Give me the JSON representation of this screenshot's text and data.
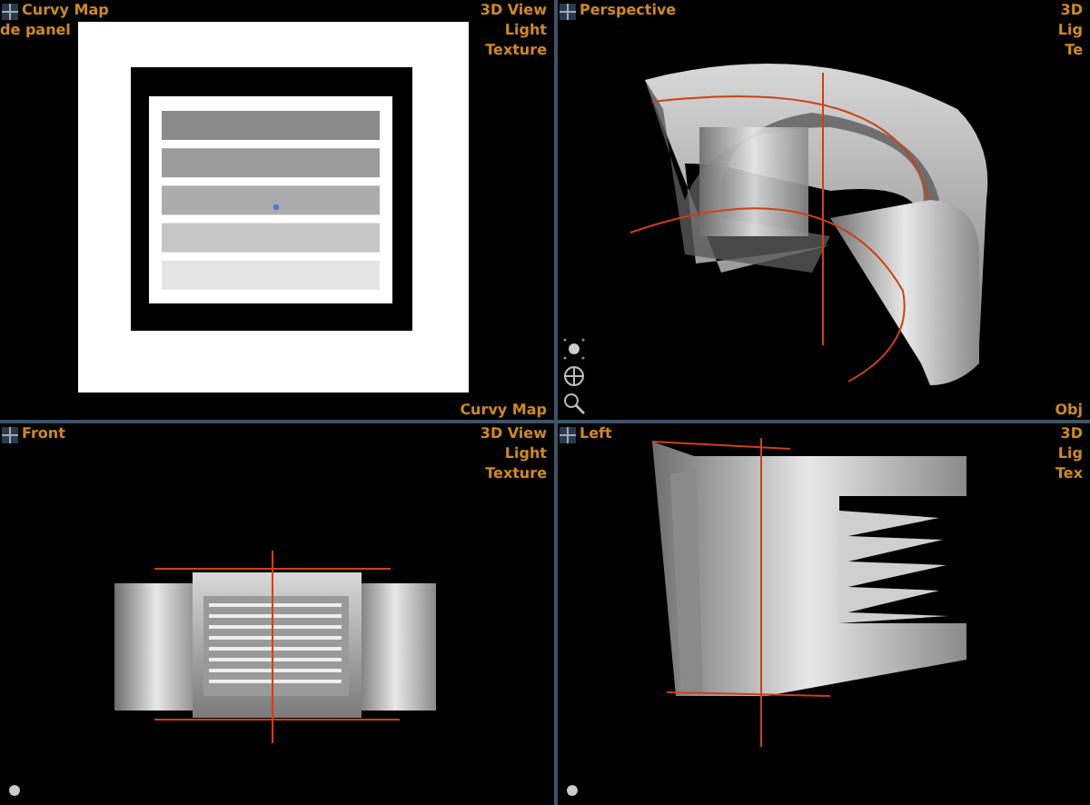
{
  "viewports": [
    {
      "kind": "map",
      "title": "Curvy Map",
      "subtitle": "de panel",
      "options": [
        "3D View",
        "Light",
        "Texture"
      ],
      "footer": "Curvy Map",
      "bands": [
        {
          "color": "#8a8a8a"
        },
        {
          "color": "#9c9c9c"
        },
        {
          "color": "#acacac"
        },
        {
          "color": "#c6c6c6"
        },
        {
          "color": "#e4e4e4"
        }
      ]
    },
    {
      "kind": "perspective",
      "title": "Perspective",
      "options": [
        "3D",
        "Lig",
        "Te"
      ],
      "footer": "Obj"
    },
    {
      "kind": "front",
      "title": "Front",
      "options": [
        "3D View",
        "Light",
        "Texture"
      ]
    },
    {
      "kind": "left",
      "title": "Left",
      "options": [
        "3D",
        "Lig",
        "Tex"
      ]
    }
  ]
}
